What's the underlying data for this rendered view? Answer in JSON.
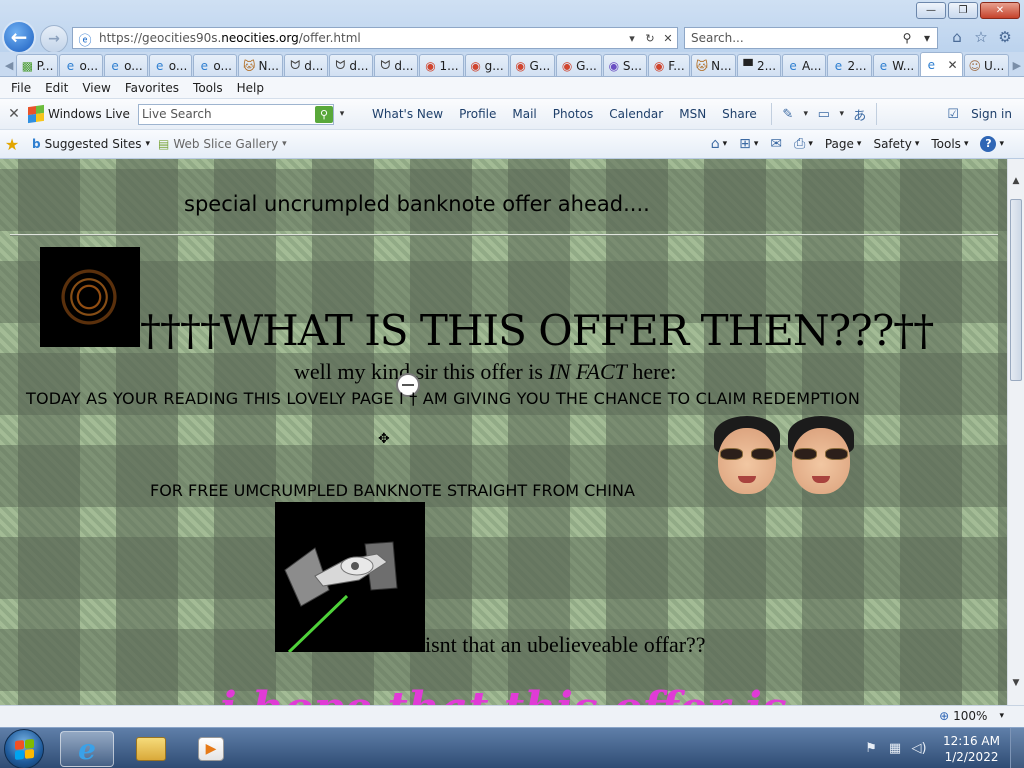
{
  "browser": {
    "url_prefix": "https://geocities90s.",
    "url_domain": "neocities.org",
    "url_path": "/offer.html",
    "search_placeholder": "Search...",
    "window_controls": [
      "—",
      "❐",
      "✕"
    ]
  },
  "tabs": [
    {
      "label": "P...",
      "icon": "green-page-icon",
      "glyph": "▩",
      "color": "#4a9c2f"
    },
    {
      "label": "o...",
      "icon": "ie-page-icon",
      "glyph": "e",
      "color": "#2f7fd0"
    },
    {
      "label": "o...",
      "icon": "ie-page-icon",
      "glyph": "e",
      "color": "#2f7fd0"
    },
    {
      "label": "o...",
      "icon": "ie-page-icon",
      "glyph": "e",
      "color": "#2f7fd0"
    },
    {
      "label": "o...",
      "icon": "ie-page-icon",
      "glyph": "e",
      "color": "#2f7fd0"
    },
    {
      "label": "N...",
      "icon": "cat-icon",
      "glyph": "🐱",
      "color": "#b06a1e"
    },
    {
      "label": "d...",
      "icon": "bird-icon",
      "glyph": "ᗢ",
      "color": "#444444"
    },
    {
      "label": "d...",
      "icon": "bird-icon",
      "glyph": "ᗢ",
      "color": "#444444"
    },
    {
      "label": "d...",
      "icon": "bird-icon",
      "glyph": "ᗢ",
      "color": "#444444"
    },
    {
      "label": "1...",
      "icon": "chrome-icon",
      "glyph": "◉",
      "color": "#d0452f"
    },
    {
      "label": "g...",
      "icon": "chrome-icon",
      "glyph": "◉",
      "color": "#d0452f"
    },
    {
      "label": "G...",
      "icon": "chrome-icon",
      "glyph": "◉",
      "color": "#d0452f"
    },
    {
      "label": "G...",
      "icon": "chrome-icon",
      "glyph": "◉",
      "color": "#d0452f"
    },
    {
      "label": "S...",
      "icon": "chrome-icon",
      "glyph": "◉",
      "color": "#6a4fc2"
    },
    {
      "label": "F...",
      "icon": "chrome-icon",
      "glyph": "◉",
      "color": "#d0452f"
    },
    {
      "label": "N...",
      "icon": "cat-icon",
      "glyph": "🐱",
      "color": "#b06a1e"
    },
    {
      "label": "2...",
      "icon": "black-square-icon",
      "glyph": "▀",
      "color": "#222222"
    },
    {
      "label": "A...",
      "icon": "ie-page-icon",
      "glyph": "e",
      "color": "#2f7fd0"
    },
    {
      "label": "2...",
      "icon": "ie-page-icon",
      "glyph": "e",
      "color": "#2f7fd0"
    },
    {
      "label": "W...",
      "icon": "ie-page-icon",
      "glyph": "e",
      "color": "#2f7fd0"
    },
    {
      "label": "",
      "icon": "ie-page-icon",
      "glyph": "e",
      "color": "#2f7fd0",
      "active": true
    },
    {
      "label": "U...",
      "icon": "avatar-icon",
      "glyph": "☺",
      "color": "#a0704a"
    }
  ],
  "menu": [
    "File",
    "Edit",
    "View",
    "Favorites",
    "Tools",
    "Help"
  ],
  "live_toolbar": {
    "brand": "Windows Live",
    "search_placeholder": "Live Search",
    "links": [
      "What's New",
      "Profile",
      "Mail",
      "Photos",
      "Calendar",
      "MSN",
      "Share"
    ],
    "signin": "Sign in"
  },
  "favorites_bar": {
    "items": [
      "Suggested Sites",
      "Web Slice Gallery"
    ],
    "commands": [
      "Page",
      "Safety",
      "Tools"
    ]
  },
  "page": {
    "line1": "special uncrumpled banknote offer ahead....",
    "heading": "††††WHAT IS THIS OFFER THEN???††",
    "line2_before": "well my kind sir this offer is ",
    "line2_em": "IN FACT",
    "line2_after": " here:",
    "line3": "TODAY AS YOUR READING THIS LOVELY PAGE I † AM GIVING YOU THE CHANCE TO CLAIM REDEMPTION",
    "line4": "FOR FREE UMCRUMPLED BANKNOTE STRAIGHT FROM CHINA",
    "line5": "isnt that an ubelieveable offar??",
    "line6": "i hope that this offer is"
  },
  "status": {
    "zoom": "100%"
  },
  "taskbar": {
    "time": "12:16 AM",
    "date": "1/2/2022"
  },
  "colors": {
    "magenta_text": "#e03bd6",
    "laser": "#4fd23a"
  }
}
